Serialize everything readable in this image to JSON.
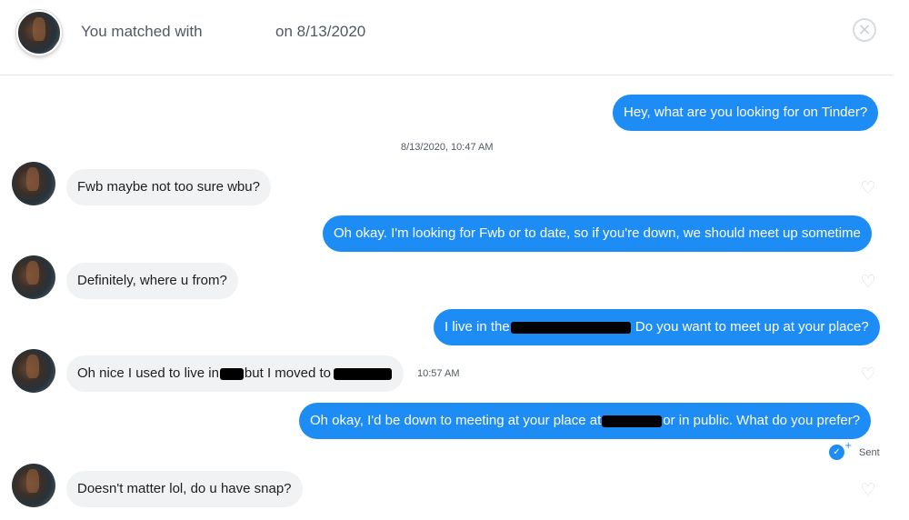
{
  "header": {
    "match_prefix": "You matched with",
    "match_date": "on 8/13/2020",
    "close_glyph": "×"
  },
  "messages": [
    {
      "side": "sent",
      "text": "Hey, what are you looking for on Tinder?"
    },
    {
      "side": "meta",
      "text": "8/13/2020, 10:47 AM"
    },
    {
      "side": "recv",
      "text": "Fwb maybe not too sure wbu?"
    },
    {
      "side": "sent",
      "text": "Oh okay. I'm looking for Fwb or to date, so if you're down, we should meet up sometime"
    },
    {
      "side": "recv",
      "text": "Definitely, where u from?"
    },
    {
      "side": "sent",
      "text_before": "I live in the",
      "text_after": " Do you want to meet up at your place?",
      "redacted": true
    },
    {
      "side": "recv",
      "text_1": "Oh nice I used to live in",
      "text_2": "but I moved to",
      "redacted": true,
      "time": "10:57 AM"
    },
    {
      "side": "sent",
      "text_before": "Oh okay, I'd be down to meeting at your place at",
      "text_after": "or in public. What do you prefer?",
      "redacted": true
    },
    {
      "side": "recv",
      "text": "Doesn't matter lol, do u have snap?"
    }
  ],
  "status": {
    "sent_label": "Sent",
    "sent_icon": "double-check-icon"
  },
  "icons": {
    "heart": "♡",
    "check": "✓",
    "plus": "+"
  },
  "colors": {
    "sent_bubble": "#1d8cf5",
    "recv_bubble": "#f0f2f4"
  }
}
